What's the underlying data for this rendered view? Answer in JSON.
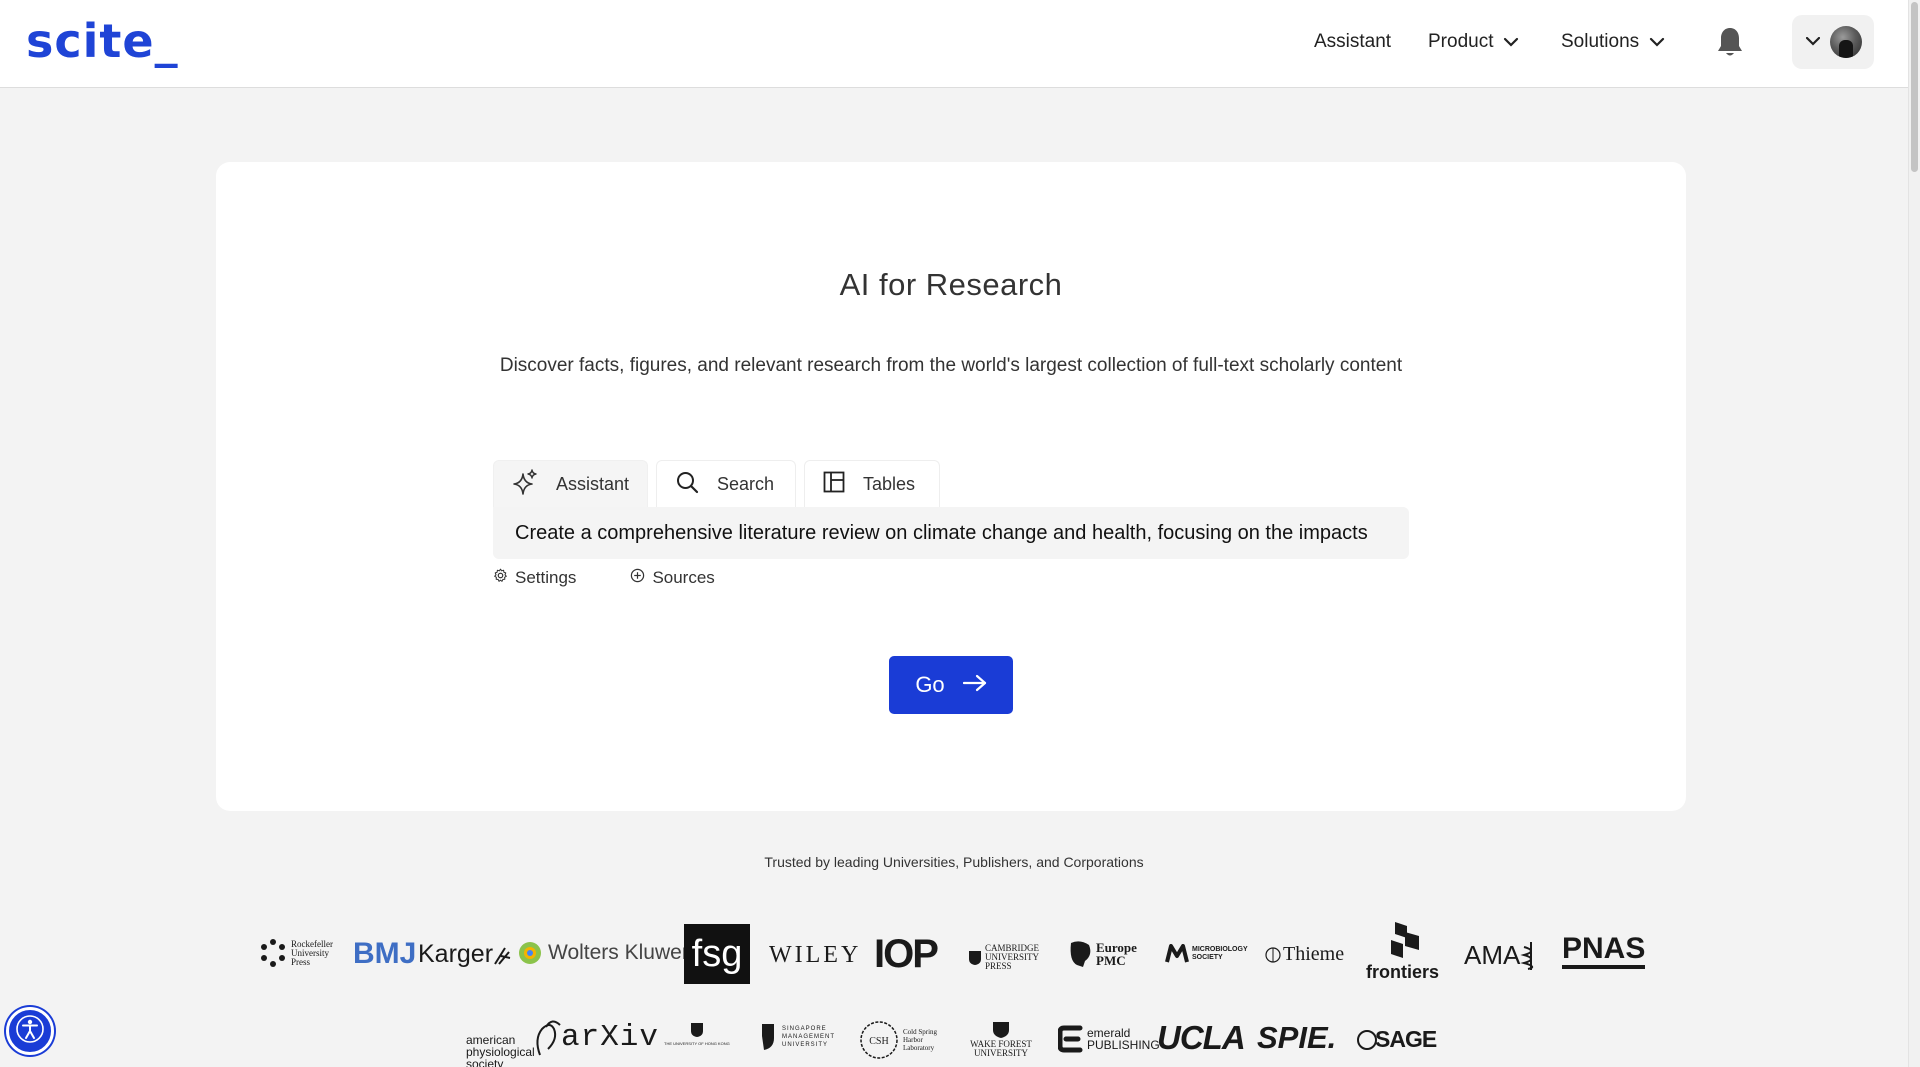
{
  "header": {
    "logo": "scite_",
    "nav": {
      "assistant": "Assistant",
      "product": "Product",
      "solutions": "Solutions"
    }
  },
  "main": {
    "title": "AI for Research",
    "subtitle": "Discover facts, figures, and relevant research from the world's largest collection of full-text scholarly content",
    "tabs": [
      {
        "label": "Assistant",
        "icon": "sparkle-icon",
        "active": true
      },
      {
        "label": "Search",
        "icon": "search-icon",
        "active": false
      },
      {
        "label": "Tables",
        "icon": "table-icon",
        "active": false
      }
    ],
    "query_value": "Create a comprehensive literature review on climate change and health, focusing on the impacts",
    "settings_label": "Settings",
    "sources_label": "Sources",
    "go_label": "Go"
  },
  "trusted": {
    "text": "Trusted by leading Universities, Publishers, and Corporations",
    "row1": [
      "Rockefeller University Press",
      "BMJ",
      "Karger",
      "Wolters Kluwer",
      "fsg",
      "WILEY",
      "IOP",
      "CAMBRIDGE UNIVERSITY PRESS",
      "Europe PMC",
      "MICROBIOLOGY SOCIETY",
      "Thieme",
      "frontiers",
      "AMA",
      "PNAS"
    ],
    "row2": [
      "american physiological society",
      "arXiv",
      "THE UNIVERSITY OF HONG KONG",
      "SINGAPORE MANAGEMENT UNIVERSITY",
      "Cold Spring Harbor Laboratory",
      "WAKE FOREST UNIVERSITY",
      "emerald PUBLISHING",
      "UCLA",
      "SPIE.",
      "SAGE"
    ]
  },
  "colors": {
    "brand": "#1f44d6",
    "button": "#1a3cd6",
    "background": "#f3f3f3"
  }
}
